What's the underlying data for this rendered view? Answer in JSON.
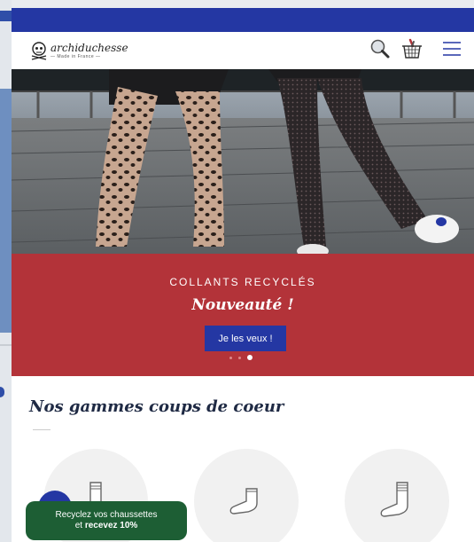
{
  "header": {
    "logo_brand": "archiduchesse",
    "logo_sub": "— Made in France —",
    "icons": [
      "search-icon",
      "basket-icon",
      "menu-icon"
    ]
  },
  "hero": {
    "kicker": "COLLANTS RECYCLÉS",
    "headline": "Nouveauté !",
    "cta_label": "Je les veux !",
    "slides_count": 3,
    "active_slide": 3
  },
  "section": {
    "title": "Nos gammes coups de coeur"
  },
  "categories": [
    {
      "icon": "tall-sock-icon"
    },
    {
      "icon": "ankle-sock-icon"
    },
    {
      "icon": "crew-sock-icon"
    }
  ],
  "promo": {
    "line1": "Recyclez vos chaussettes",
    "line2_prefix": "et ",
    "line2_bold": "recevez 10%"
  },
  "colors": {
    "brand_blue": "#2437a3",
    "banner_red": "#b33339",
    "promo_green": "#1d5e34"
  }
}
